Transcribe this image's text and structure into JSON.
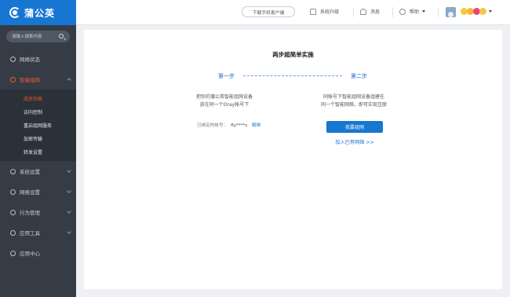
{
  "brand": {
    "name": "蒲公英"
  },
  "search": {
    "placeholder": "请输入搜索内容"
  },
  "sidebar": {
    "items": [
      {
        "label": "网络状态"
      },
      {
        "label": "智能组网"
      },
      {
        "label": "系统设置"
      },
      {
        "label": "网络设置"
      },
      {
        "label": "行为管理"
      },
      {
        "label": "应用工具"
      },
      {
        "label": "应用中心"
      }
    ],
    "subitems": [
      {
        "label": "成员列表"
      },
      {
        "label": "访问控制"
      },
      {
        "label": "重启组网服务"
      },
      {
        "label": "加密传输"
      },
      {
        "label": "转发设置"
      }
    ]
  },
  "topbar": {
    "download": "下载手机客户端",
    "upgrade": "系统升级",
    "messages": "消息",
    "help": "帮助"
  },
  "main": {
    "title": "两步超简单实施",
    "step1": "第一步",
    "step2": "第二步",
    "step1_line1": "把你的蒲公英智能组网设备",
    "step1_line2": "放在同一个Oray帐号下",
    "step2_line1": "同帐号下智能组网设备组建在",
    "step2_line2": "同一个智能网络，即可实现互联",
    "bound_label": "已绑定的帐号：",
    "bound_account": "fly****s",
    "unbind": "解绑",
    "create_button": "我要组网",
    "join_link": "加入已有网络 >>"
  },
  "colors": {
    "accent": "#1676d2",
    "active": "#f05a32",
    "sidebar": "#353c45"
  }
}
